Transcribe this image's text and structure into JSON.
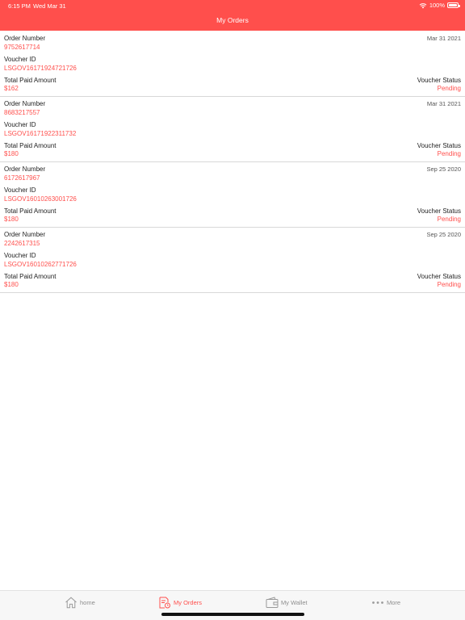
{
  "status_bar": {
    "time": "6:15 PM",
    "date": "Wed Mar 31",
    "battery": "100%"
  },
  "header": {
    "title": "My Orders"
  },
  "labels": {
    "order_number": "Order Number",
    "voucher_id": "Voucher ID",
    "total_paid": "Total Paid Amount",
    "voucher_status": "Voucher Status"
  },
  "orders": [
    {
      "order_number": "9752617714",
      "date": "Mar 31 2021",
      "voucher_id": "LSGOV16171924721726",
      "amount": "$162",
      "status": "Pending"
    },
    {
      "order_number": "8683217557",
      "date": "Mar 31 2021",
      "voucher_id": "LSGOV16171922311732",
      "amount": "$180",
      "status": "Pending"
    },
    {
      "order_number": "6172617967",
      "date": "Sep 25 2020",
      "voucher_id": "LSGOV16010263001726",
      "amount": "$180",
      "status": "Pending"
    },
    {
      "order_number": "2242617315",
      "date": "Sep 25 2020",
      "voucher_id": "LSGOV16010262771726",
      "amount": "$180",
      "status": "Pending"
    }
  ],
  "tabbar": {
    "tabs": [
      {
        "label": "home",
        "icon": "home-icon",
        "active": false
      },
      {
        "label": "My Orders",
        "icon": "orders-icon",
        "active": true
      },
      {
        "label": "My Wallet",
        "icon": "wallet-icon",
        "active": false
      },
      {
        "label": "More",
        "icon": "more-icon",
        "active": false
      }
    ]
  },
  "colors": {
    "accent": "#ff4f4c"
  }
}
